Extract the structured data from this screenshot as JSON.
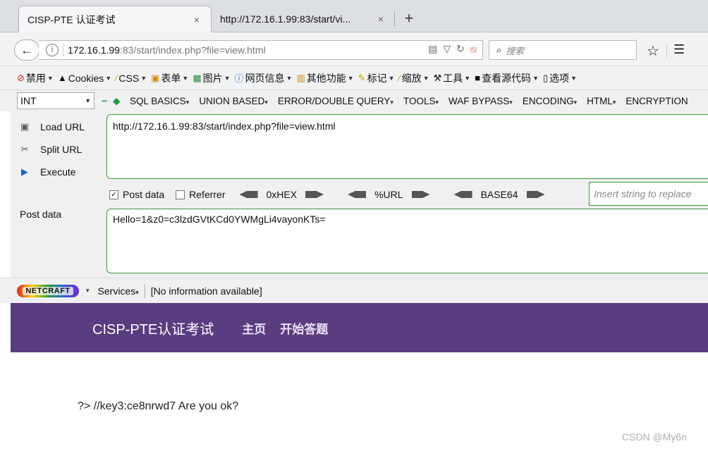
{
  "tabs": [
    {
      "label": "CISP-PTE 认证考试",
      "active": true
    },
    {
      "label": "http://172.16.1.99:83/start/vi...",
      "active": false
    }
  ],
  "tab_close_glyph": "×",
  "new_tab_glyph": "+",
  "navigation": {
    "url_host": "172.16.1.99",
    "url_rest": ":83/start/index.php?file=view.html",
    "search_placeholder": "搜索"
  },
  "bookmarks": [
    {
      "label": "禁用",
      "icon": "block-icon"
    },
    {
      "label": "Cookies",
      "icon": "user-icon"
    },
    {
      "label": "CSS",
      "icon": "wand-icon"
    },
    {
      "label": "表单",
      "icon": "form-icon"
    },
    {
      "label": "图片",
      "icon": "image-icon"
    },
    {
      "label": "网页信息",
      "icon": "info-icon"
    },
    {
      "label": "其他功能",
      "icon": "misc-icon"
    },
    {
      "label": "标记",
      "icon": "pencil-icon"
    },
    {
      "label": "缩放",
      "icon": "zoom-icon"
    },
    {
      "label": "工具",
      "icon": "tools-icon"
    },
    {
      "label": "查看源代码",
      "icon": "source-icon"
    },
    {
      "label": "选项",
      "icon": "options-icon"
    }
  ],
  "hackbar": {
    "select_value": "INT",
    "menus": [
      "SQL BASICS",
      "UNION BASED",
      "ERROR/DOUBLE QUERY",
      "TOOLS",
      "WAF BYPASS",
      "ENCODING",
      "HTML",
      "ENCRYPTION"
    ],
    "left_tools": [
      {
        "label": "Load URL",
        "icon": "load-url-icon"
      },
      {
        "label": "Split URL",
        "icon": "split-url-icon"
      },
      {
        "label": "Execute",
        "icon": "execute-icon"
      }
    ],
    "url_value": "http://172.16.1.99:83/start/index.php?file=view.html",
    "post_data_checked": true,
    "post_data_label": "Post data",
    "referrer_checked": false,
    "referrer_label": "Referrer",
    "encoders": [
      "0xHEX",
      "%URL",
      "BASE64"
    ],
    "replace_placeholder": "Insert string to replace",
    "post_data_field_label": "Post data",
    "post_data_value": "Hello=1&z0=c3lzdGVtKCd0YWMgLi4vayonKTs="
  },
  "netcraft": {
    "logo_text": "NETCRAFT",
    "services_label": "Services",
    "status": "[No information available]"
  },
  "site": {
    "title": "CISP-PTE认证考试",
    "nav": [
      "主页",
      "开始答题"
    ]
  },
  "output_text": "?> //key3:ce8nrwd7 Are you ok?",
  "watermark": "CSDN @My6n"
}
